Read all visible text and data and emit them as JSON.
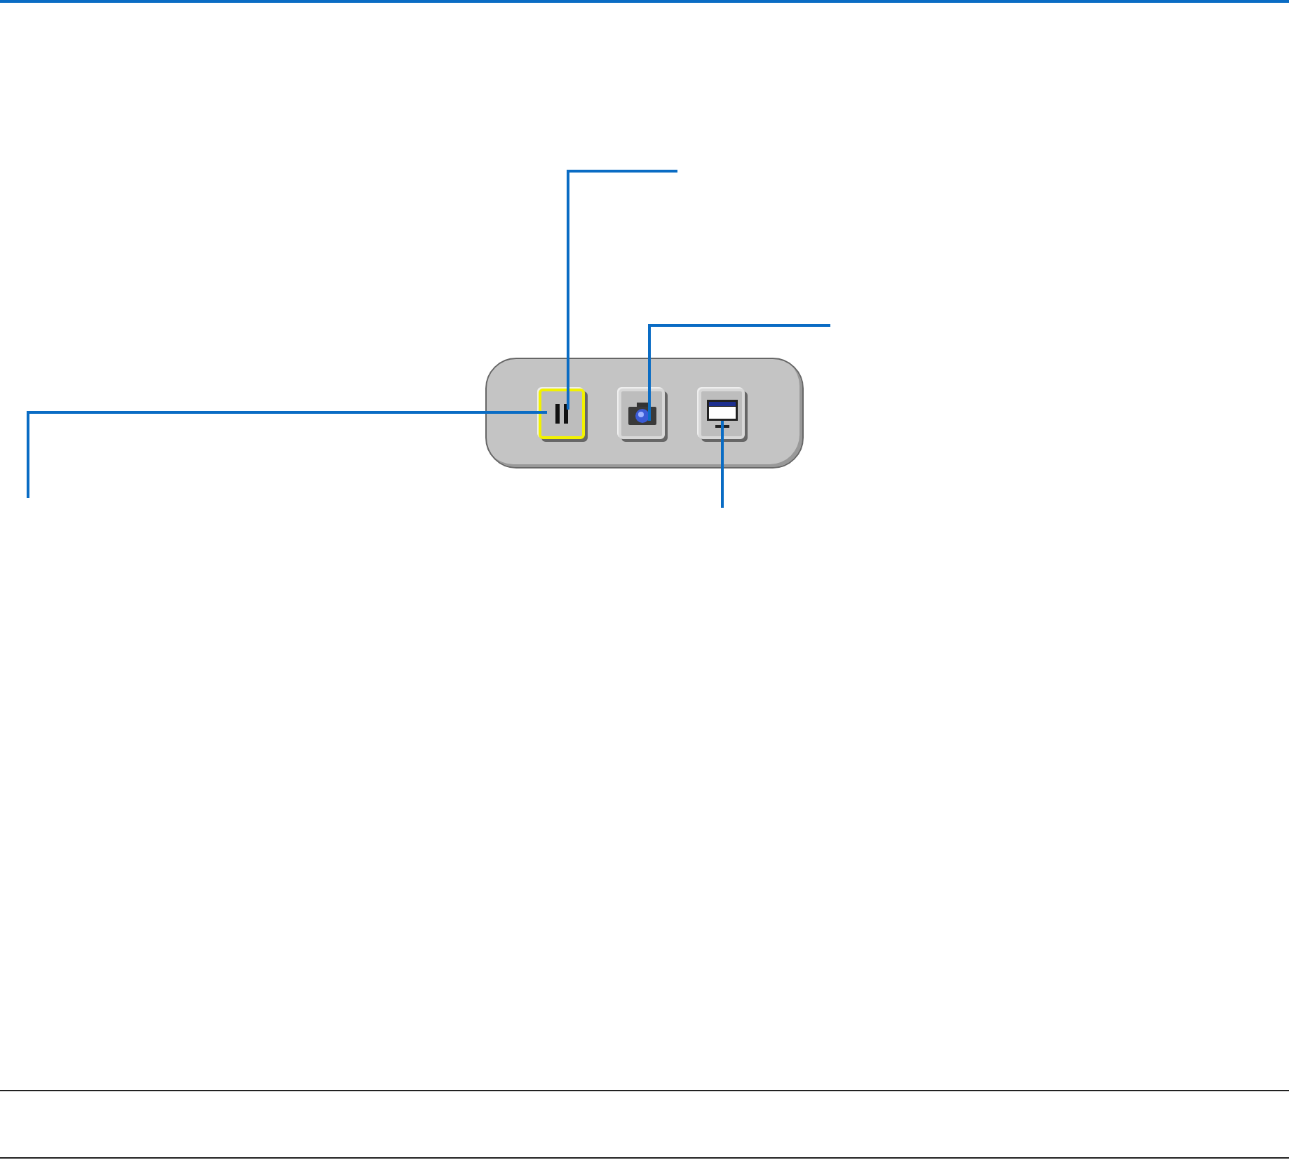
{
  "toolbar": {
    "buttons": [
      {
        "kind": "pause",
        "selected": true
      },
      {
        "kind": "camera",
        "selected": false
      },
      {
        "kind": "display",
        "selected": false
      }
    ]
  }
}
